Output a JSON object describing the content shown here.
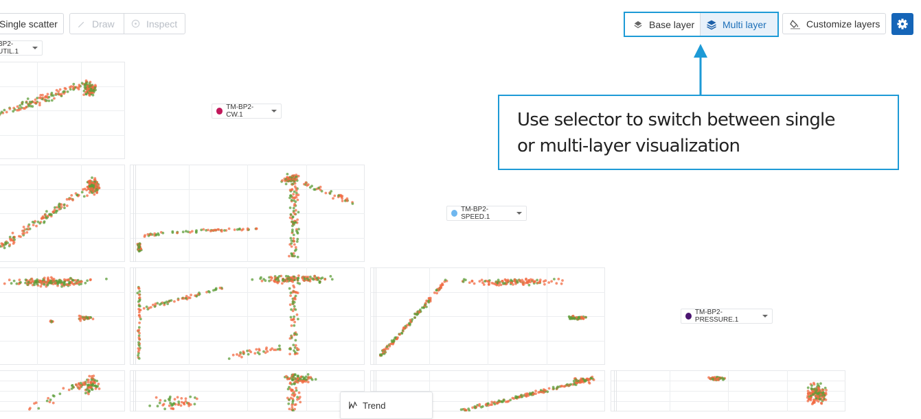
{
  "toolbar": {
    "single_scatter": "Single scatter",
    "draw": "Draw",
    "inspect": "Inspect",
    "base_layer": "Base layer",
    "multi_layer": "Multi layer",
    "customize_layers": "Customize layers"
  },
  "variables": {
    "util": "BP2-UTIL.1",
    "cw": "TM-BP2-CW.1",
    "speed": "TM-BP2-SPEED.1",
    "pressure": "TM-BP2-PRESSURE.1"
  },
  "variable_colors": {
    "cw": "#c2185b",
    "speed": "#6fb7ef",
    "pressure": "#4a1470"
  },
  "layer_colors": [
    "#f26b43",
    "#5e9e3a"
  ],
  "annotation": {
    "line1": "Use selector to switch between single",
    "line2": "or multi-layer visualization"
  },
  "context_menu": {
    "trend": "Trend"
  },
  "colors": {
    "accent": "#1d9ad6",
    "primary": "#1565b8"
  }
}
